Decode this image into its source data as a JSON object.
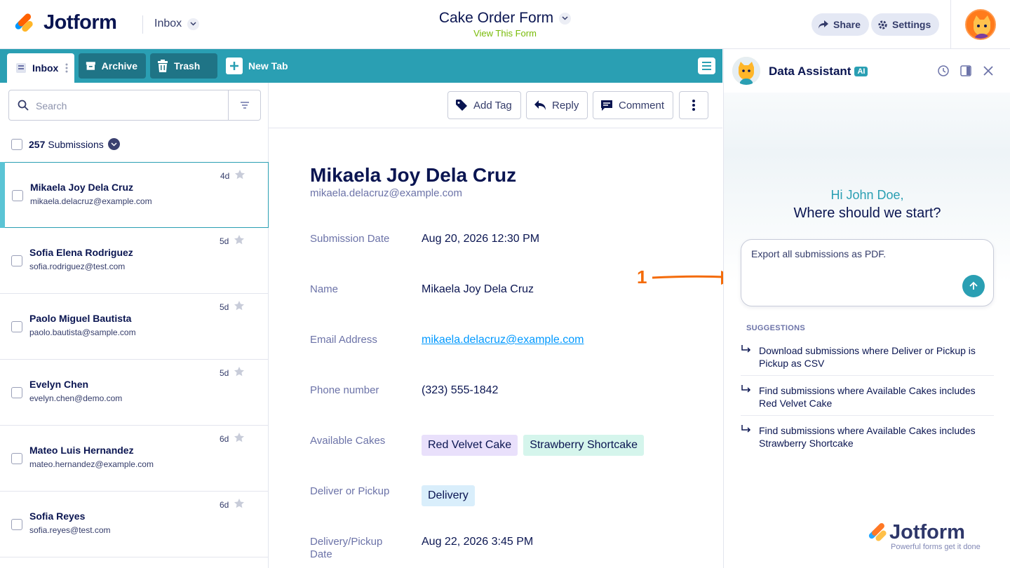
{
  "brand": {
    "name": "Jotform",
    "tagline": "Powerful forms get it done"
  },
  "header": {
    "inbox_label": "Inbox",
    "form_title": "Cake Order Form",
    "view_form_link": "View This Form",
    "share_label": "Share",
    "settings_label": "Settings"
  },
  "tabs": {
    "inbox": "Inbox",
    "archive": "Archive",
    "trash": "Trash",
    "new_tab": "New Tab"
  },
  "search": {
    "placeholder": "Search"
  },
  "list": {
    "count": "257",
    "count_label": "Submissions",
    "items": [
      {
        "name": "Mikaela Joy Dela Cruz",
        "email": "mikaela.delacruz@example.com",
        "age": "4d"
      },
      {
        "name": "Sofia Elena Rodriguez",
        "email": "sofia.rodriguez@test.com",
        "age": "5d"
      },
      {
        "name": "Paolo Miguel Bautista",
        "email": "paolo.bautista@sample.com",
        "age": "5d"
      },
      {
        "name": "Evelyn Chen",
        "email": "evelyn.chen@demo.com",
        "age": "5d"
      },
      {
        "name": "Mateo Luis Hernandez",
        "email": "mateo.hernandez@example.com",
        "age": "6d"
      },
      {
        "name": "Sofia Reyes",
        "email": "sofia.reyes@test.com",
        "age": "6d"
      }
    ]
  },
  "actions": {
    "add_tag": "Add Tag",
    "reply": "Reply",
    "comment": "Comment"
  },
  "detail": {
    "name": "Mikaela Joy Dela Cruz",
    "email": "mikaela.delacruz@example.com",
    "fields": {
      "submission_date_label": "Submission Date",
      "submission_date_value": "Aug 20, 2026 12:30 PM",
      "name_label": "Name",
      "name_value": "Mikaela Joy Dela Cruz",
      "email_label": "Email Address",
      "email_value": "mikaela.delacruz@example.com",
      "phone_label": "Phone number",
      "phone_value": "(323) 555-1842",
      "cakes_label": "Available Cakes",
      "cake_1": "Red Velvet Cake",
      "cake_2": "Strawberry Shortcake",
      "deliver_label": "Deliver or Pickup",
      "deliver_value": "Delivery",
      "delivery_date_label": "Delivery/Pickup Date",
      "delivery_date_value": "Aug 22, 2026 3:45 PM"
    }
  },
  "annotation": {
    "number": "1",
    "color": "#f46b09"
  },
  "assistant": {
    "title": "Data Assistant",
    "ai_badge": "AI",
    "greeting": "Hi John Doe,",
    "question": "Where should we start?",
    "prompt": "Export all submissions as PDF.",
    "suggestions_title": "SUGGESTIONS",
    "suggestions": [
      "Download submissions where Deliver or Pickup is Pickup as CSV",
      "Find submissions where Available Cakes includes Red Velvet Cake",
      "Find submissions where Available Cakes includes Strawberry Shortcake"
    ]
  },
  "colors": {
    "primary_teal": "#2a9fb3",
    "navy": "#0a1551",
    "accent_orange": "#f46b09",
    "link_green": "#78bb07",
    "chip_purple": "#e9e0fb",
    "chip_mint": "#d5f5ec",
    "chip_blue": "#d9eefb"
  }
}
